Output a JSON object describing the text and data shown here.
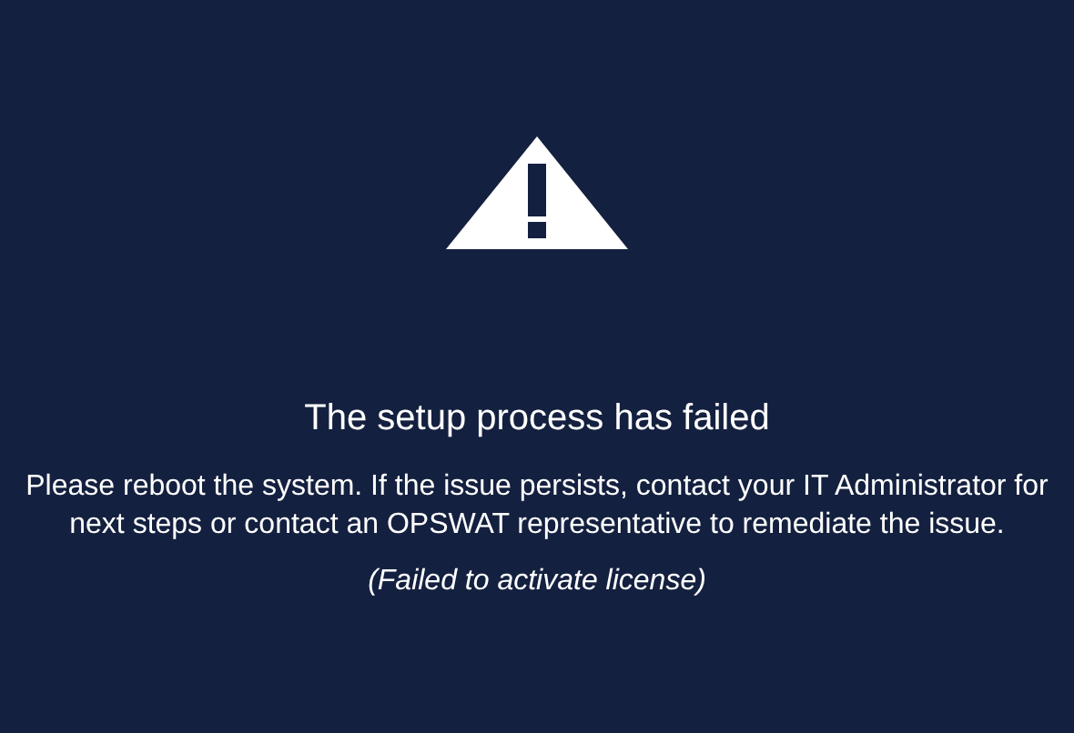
{
  "title": "The setup process has failed",
  "message": "Please reboot the system. If the issue persists, contact your IT Administrator for next steps or contact an OPSWAT representative to remediate the issue.",
  "detail": "(Failed to activate license)"
}
